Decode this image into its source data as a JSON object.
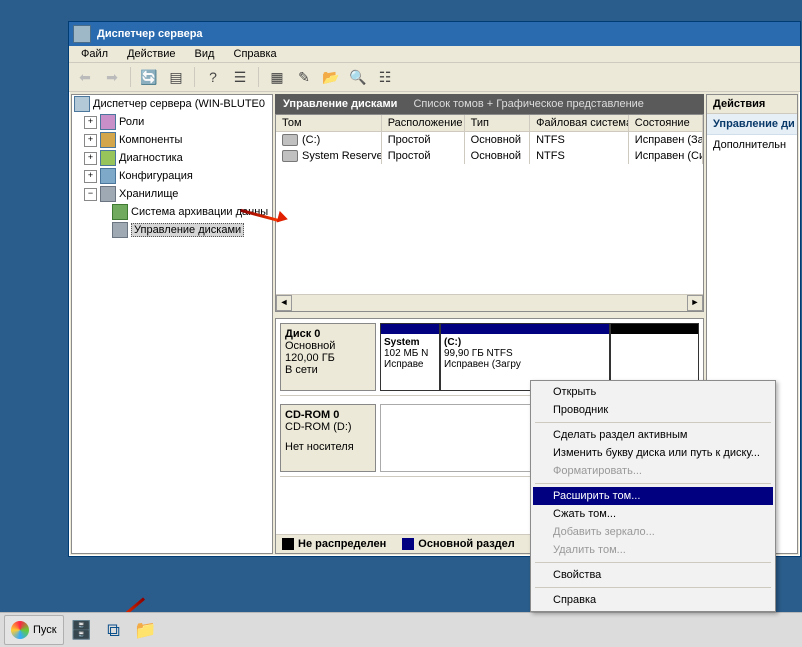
{
  "window": {
    "title": "Диспетчер сервера"
  },
  "menu": {
    "file": "Файл",
    "action": "Действие",
    "view": "Вид",
    "help": "Справка"
  },
  "tree": {
    "root": "Диспетчер сервера (WIN-BLUTE0",
    "roles": "Роли",
    "components": "Компоненты",
    "diagnostics": "Диагностика",
    "config": "Конфигурация",
    "storage": "Хранилище",
    "backup": "Система архивации данны",
    "diskmgmt": "Управление дисками"
  },
  "header": {
    "title": "Управление дисками",
    "subtitle": "Список томов + Графическое представление"
  },
  "columns": {
    "volume": "Том",
    "layout": "Расположение",
    "type": "Тип",
    "fs": "Файловая система",
    "state": "Состояние"
  },
  "volumes": [
    {
      "name": "(C:)",
      "layout": "Простой",
      "type": "Основной",
      "fs": "NTFS",
      "state": "Исправен (За"
    },
    {
      "name": "System Reserved",
      "layout": "Простой",
      "type": "Основной",
      "fs": "NTFS",
      "state": "Исправен (Си"
    }
  ],
  "disk0": {
    "name": "Диск 0",
    "kind": "Основной",
    "size": "120,00 ГБ",
    "status": "В сети",
    "parts": [
      {
        "title": "System",
        "sub1": "102 МБ N",
        "sub2": "Исправе"
      },
      {
        "title": "(C:)",
        "sub1": "99,90 ГБ NTFS",
        "sub2": "Исправен (Загру"
      }
    ]
  },
  "cdrom": {
    "name": "CD-ROM 0",
    "kind": "CD-ROM (D:)",
    "status": "Нет носителя"
  },
  "legend": {
    "unalloc": "Не распределен",
    "primary": "Основной раздел"
  },
  "actions": {
    "head": "Действия",
    "panel": "Управление ди",
    "more": "Дополнительн"
  },
  "context": {
    "open": "Открыть",
    "explorer": "Проводник",
    "active": "Сделать раздел активным",
    "letter": "Изменить букву диска или путь к диску...",
    "format": "Форматировать...",
    "extend": "Расширить том...",
    "shrink": "Сжать том...",
    "mirror": "Добавить зеркало...",
    "delete": "Удалить том...",
    "props": "Свойства",
    "help": "Справка"
  },
  "taskbar": {
    "start": "Пуск"
  }
}
